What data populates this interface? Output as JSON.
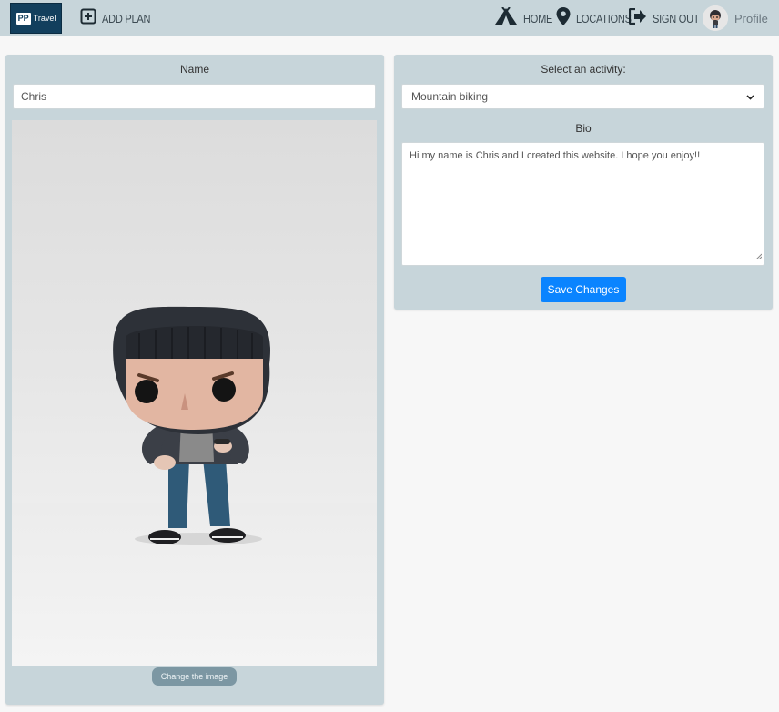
{
  "navbar": {
    "logo": {
      "badge": "PP",
      "text": "Travel"
    },
    "add_plan": "ADD PLAN",
    "home": "HOME",
    "locations": "LOCATIONS",
    "sign_out": "SIGN OUT",
    "profile": "Profile"
  },
  "profile_form": {
    "name_label": "Name",
    "name_value": "Chris",
    "change_image_label": "Change the image"
  },
  "activity_form": {
    "activity_label": "Select an activity:",
    "activity_selected": "Mountain biking",
    "bio_label": "Bio",
    "bio_value": "Hi my name is Chris and I created this website. I hope you enjoy!!",
    "save_label": "Save Changes"
  },
  "colors": {
    "navbar_bg": "#c7d5da",
    "panel_bg": "#c7d5da",
    "logo_bg": "#123f5d",
    "primary_button": "#0a84ff",
    "secondary_button": "#7c97a3"
  },
  "icons": {
    "add_plan": "plus-square-icon",
    "home": "tent-icon",
    "locations": "map-pin-icon",
    "sign_out": "sign-out-icon",
    "profile": "avatar-icon",
    "select": "chevron-down-icon"
  }
}
